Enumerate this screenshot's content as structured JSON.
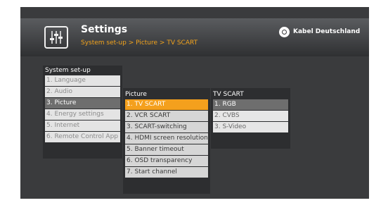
{
  "header": {
    "title": "Settings",
    "breadcrumb": "System set-up > Picture > TV SCART",
    "brand": "Kabel Deutschland",
    "settings_icon": "equalizer-sliders-icon",
    "brand_icon": "kabel-deutschland-logo"
  },
  "columns": [
    {
      "title": "System set-up",
      "items": [
        "1. Language",
        "2. Audio",
        "3. Picture",
        "4. Energy settings",
        "5. Internet",
        "6. Remote Control App"
      ],
      "selected_index": 2
    },
    {
      "title": "Picture",
      "items": [
        "1. TV SCART",
        "2. VCR SCART",
        "3. SCART-switching",
        "4. HDMI screen resolution",
        "5. Banner timeout",
        "6. OSD transparency",
        "7. Start channel"
      ],
      "active_index": 0
    },
    {
      "title": "TV SCART",
      "items": [
        "1. RGB",
        "2. CVBS",
        "3. S-Video"
      ],
      "selected_index": 0
    }
  ],
  "colors": {
    "accent": "#f4a01d",
    "selected": "#6e6e6e",
    "background": "#3a3b3d"
  }
}
